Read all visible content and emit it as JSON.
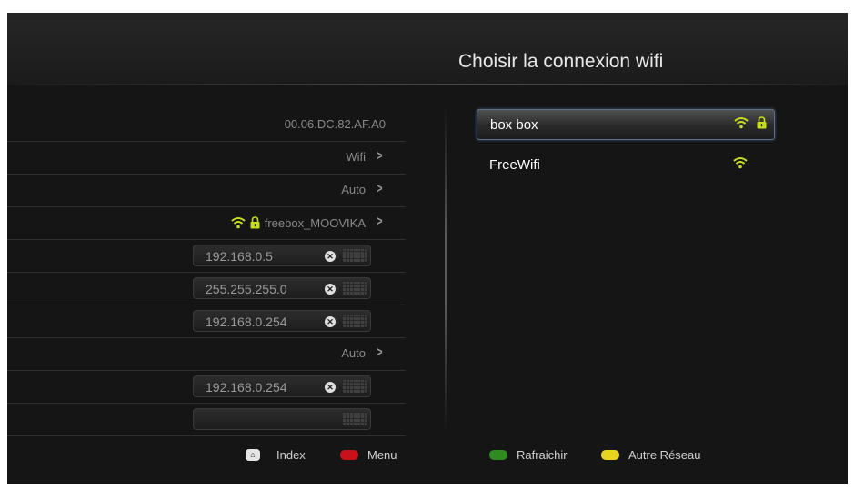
{
  "title": "Choisir la connexion wifi",
  "settings": {
    "mac_address": "00.06.DC.82.AF.A0",
    "connection_type": "Wifi",
    "ip_mode": "Auto",
    "current_network": "freebox_MOOVIKA",
    "ip_address": "192.168.0.5",
    "subnet_mask": "255.255.255.0",
    "gateway": "192.168.0.254",
    "dns_mode": "Auto",
    "dns_primary": "192.168.0.254",
    "dns_secondary": ""
  },
  "networks": [
    {
      "name": "box box",
      "signal_icon": "wifi-icon",
      "secured": true,
      "selected": true
    },
    {
      "name": "FreeWifi",
      "signal_icon": "wifi-icon",
      "secured": false,
      "selected": false
    }
  ],
  "footer": {
    "index_label": "Index",
    "menu_label": "Menu",
    "refresh_label": "Rafraichir",
    "other_network_label": "Autre Réseau"
  },
  "colors": {
    "background": "#151515",
    "wifi_icon": "#c8dc20",
    "red_key": "#c8111a",
    "green_key": "#2f8a1f",
    "yellow_key": "#e8d41e",
    "selection_border": "#5b6f88"
  }
}
